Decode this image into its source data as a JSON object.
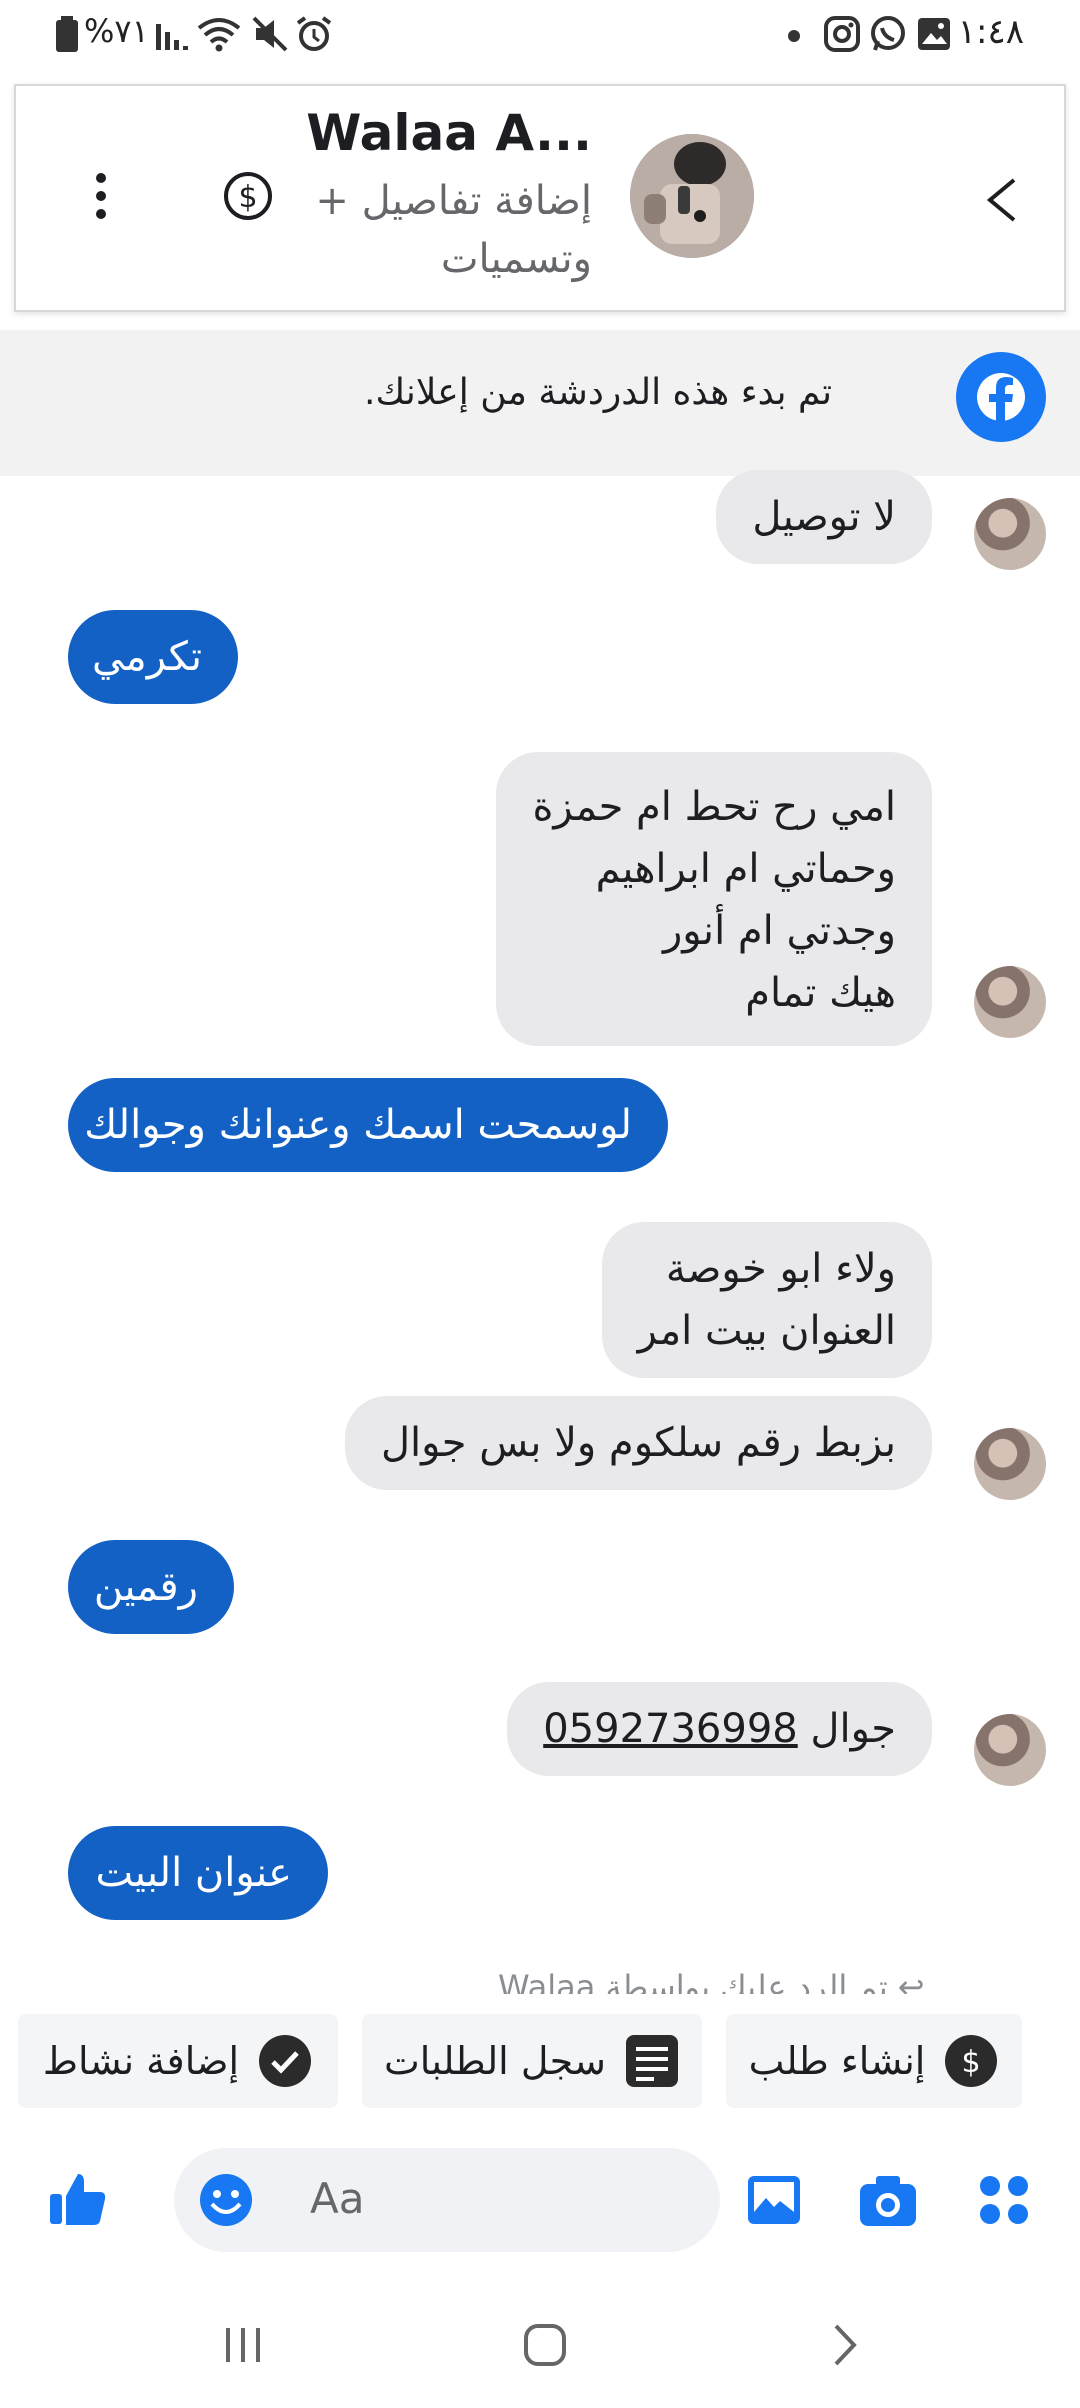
{
  "status_bar": {
    "time": "١:٤٨",
    "battery": "%٧١",
    "notification_icons": [
      "dot-icon",
      "instagram-icon",
      "whatsapp-icon",
      "gallery-icon"
    ],
    "system_icons": [
      "battery-icon",
      "signal-icon",
      "wifi-icon",
      "mute-icon",
      "alarm-icon"
    ]
  },
  "header": {
    "contact_name": "Walaa A...",
    "add_details_line1": "+ إضافة تفاصيل",
    "add_details_line2": "وتسميات"
  },
  "banner": {
    "text": ".تم بدء هذه الدردشة من إعلانك"
  },
  "messages": [
    {
      "side": "in",
      "lines": [
        "لا توصيل"
      ]
    },
    {
      "side": "out",
      "lines": [
        "تكرمي"
      ]
    },
    {
      "side": "in",
      "lines": [
        "امي رح تحط ام حمزة",
        "وحماتي ام ابراهيم",
        "وجدتي ام أنور",
        "هيك تمام"
      ]
    },
    {
      "side": "out",
      "lines": [
        "لوسمحت اسمك وعنوانك وجوالك"
      ]
    },
    {
      "side": "in",
      "lines": [
        "ولاء ابو خوصة",
        "العنوان بيت امر"
      ]
    },
    {
      "side": "in",
      "lines": [
        "بزبط رقم سلكوم ولا بس جوال"
      ]
    },
    {
      "side": "out",
      "lines": [
        "رقمين"
      ]
    },
    {
      "side": "in",
      "prefix": "جوال ",
      "phone": "0592736998"
    },
    {
      "side": "out",
      "lines": [
        "عنوان البيت"
      ]
    }
  ],
  "replied_note": "تم الرد عليك بواسطة Walaa",
  "quick_actions": {
    "create_order": "إنشاء طلب",
    "order_history": "سجل الطلبات",
    "add_activity": "إضافة نشاط"
  },
  "composer": {
    "placeholder": "Aa"
  },
  "colors": {
    "brand_blue": "#1877f2",
    "outgoing_bubble": "#1361c4",
    "incoming_bubble": "#e9e9eb"
  }
}
